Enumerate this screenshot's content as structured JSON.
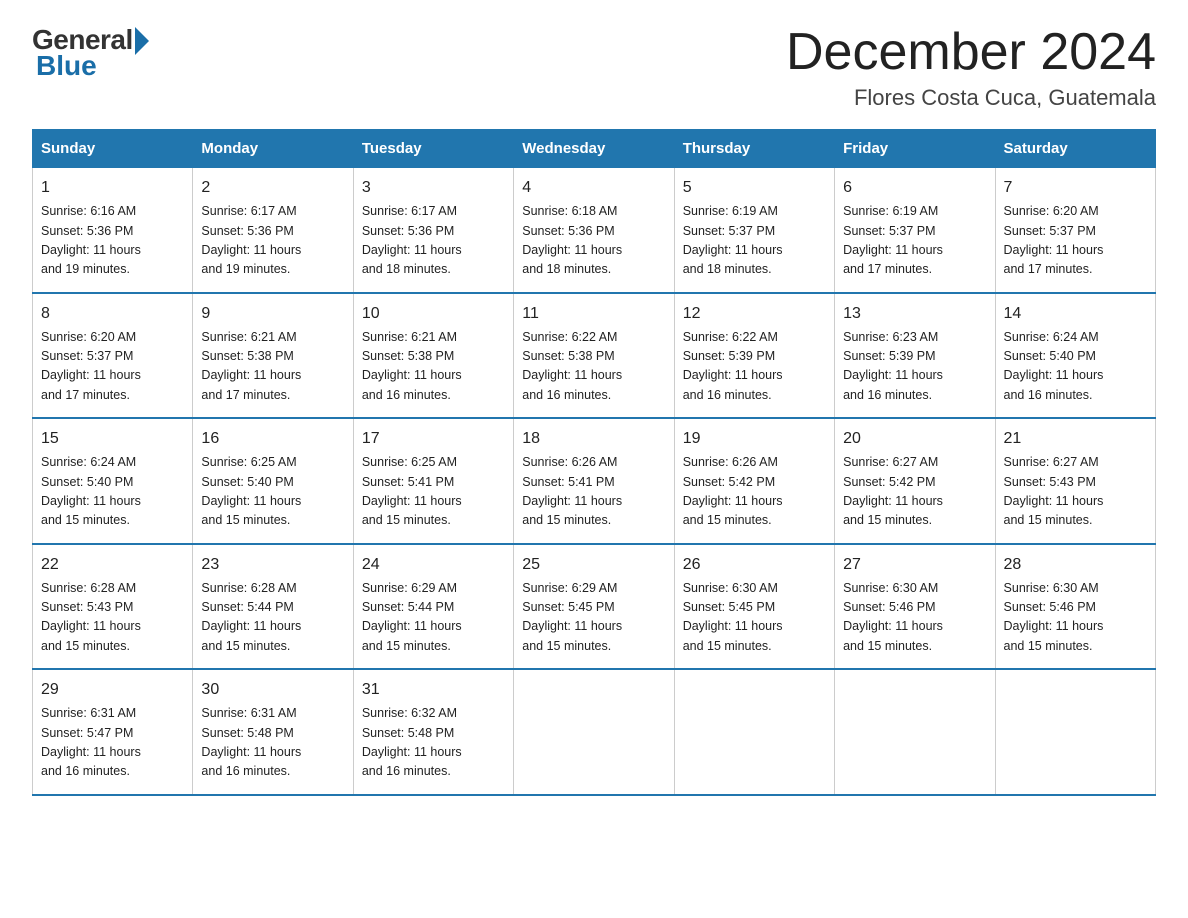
{
  "logo": {
    "general": "General",
    "blue": "Blue"
  },
  "title": "December 2024",
  "location": "Flores Costa Cuca, Guatemala",
  "days_of_week": [
    "Sunday",
    "Monday",
    "Tuesday",
    "Wednesday",
    "Thursday",
    "Friday",
    "Saturday"
  ],
  "weeks": [
    [
      {
        "day": "1",
        "sunrise": "6:16 AM",
        "sunset": "5:36 PM",
        "daylight": "11 hours and 19 minutes."
      },
      {
        "day": "2",
        "sunrise": "6:17 AM",
        "sunset": "5:36 PM",
        "daylight": "11 hours and 19 minutes."
      },
      {
        "day": "3",
        "sunrise": "6:17 AM",
        "sunset": "5:36 PM",
        "daylight": "11 hours and 18 minutes."
      },
      {
        "day": "4",
        "sunrise": "6:18 AM",
        "sunset": "5:36 PM",
        "daylight": "11 hours and 18 minutes."
      },
      {
        "day": "5",
        "sunrise": "6:19 AM",
        "sunset": "5:37 PM",
        "daylight": "11 hours and 18 minutes."
      },
      {
        "day": "6",
        "sunrise": "6:19 AM",
        "sunset": "5:37 PM",
        "daylight": "11 hours and 17 minutes."
      },
      {
        "day": "7",
        "sunrise": "6:20 AM",
        "sunset": "5:37 PM",
        "daylight": "11 hours and 17 minutes."
      }
    ],
    [
      {
        "day": "8",
        "sunrise": "6:20 AM",
        "sunset": "5:37 PM",
        "daylight": "11 hours and 17 minutes."
      },
      {
        "day": "9",
        "sunrise": "6:21 AM",
        "sunset": "5:38 PM",
        "daylight": "11 hours and 17 minutes."
      },
      {
        "day": "10",
        "sunrise": "6:21 AM",
        "sunset": "5:38 PM",
        "daylight": "11 hours and 16 minutes."
      },
      {
        "day": "11",
        "sunrise": "6:22 AM",
        "sunset": "5:38 PM",
        "daylight": "11 hours and 16 minutes."
      },
      {
        "day": "12",
        "sunrise": "6:22 AM",
        "sunset": "5:39 PM",
        "daylight": "11 hours and 16 minutes."
      },
      {
        "day": "13",
        "sunrise": "6:23 AM",
        "sunset": "5:39 PM",
        "daylight": "11 hours and 16 minutes."
      },
      {
        "day": "14",
        "sunrise": "6:24 AM",
        "sunset": "5:40 PM",
        "daylight": "11 hours and 16 minutes."
      }
    ],
    [
      {
        "day": "15",
        "sunrise": "6:24 AM",
        "sunset": "5:40 PM",
        "daylight": "11 hours and 15 minutes."
      },
      {
        "day": "16",
        "sunrise": "6:25 AM",
        "sunset": "5:40 PM",
        "daylight": "11 hours and 15 minutes."
      },
      {
        "day": "17",
        "sunrise": "6:25 AM",
        "sunset": "5:41 PM",
        "daylight": "11 hours and 15 minutes."
      },
      {
        "day": "18",
        "sunrise": "6:26 AM",
        "sunset": "5:41 PM",
        "daylight": "11 hours and 15 minutes."
      },
      {
        "day": "19",
        "sunrise": "6:26 AM",
        "sunset": "5:42 PM",
        "daylight": "11 hours and 15 minutes."
      },
      {
        "day": "20",
        "sunrise": "6:27 AM",
        "sunset": "5:42 PM",
        "daylight": "11 hours and 15 minutes."
      },
      {
        "day": "21",
        "sunrise": "6:27 AM",
        "sunset": "5:43 PM",
        "daylight": "11 hours and 15 minutes."
      }
    ],
    [
      {
        "day": "22",
        "sunrise": "6:28 AM",
        "sunset": "5:43 PM",
        "daylight": "11 hours and 15 minutes."
      },
      {
        "day": "23",
        "sunrise": "6:28 AM",
        "sunset": "5:44 PM",
        "daylight": "11 hours and 15 minutes."
      },
      {
        "day": "24",
        "sunrise": "6:29 AM",
        "sunset": "5:44 PM",
        "daylight": "11 hours and 15 minutes."
      },
      {
        "day": "25",
        "sunrise": "6:29 AM",
        "sunset": "5:45 PM",
        "daylight": "11 hours and 15 minutes."
      },
      {
        "day": "26",
        "sunrise": "6:30 AM",
        "sunset": "5:45 PM",
        "daylight": "11 hours and 15 minutes."
      },
      {
        "day": "27",
        "sunrise": "6:30 AM",
        "sunset": "5:46 PM",
        "daylight": "11 hours and 15 minutes."
      },
      {
        "day": "28",
        "sunrise": "6:30 AM",
        "sunset": "5:46 PM",
        "daylight": "11 hours and 15 minutes."
      }
    ],
    [
      {
        "day": "29",
        "sunrise": "6:31 AM",
        "sunset": "5:47 PM",
        "daylight": "11 hours and 16 minutes."
      },
      {
        "day": "30",
        "sunrise": "6:31 AM",
        "sunset": "5:48 PM",
        "daylight": "11 hours and 16 minutes."
      },
      {
        "day": "31",
        "sunrise": "6:32 AM",
        "sunset": "5:48 PM",
        "daylight": "11 hours and 16 minutes."
      },
      null,
      null,
      null,
      null
    ]
  ],
  "labels": {
    "sunrise": "Sunrise:",
    "sunset": "Sunset:",
    "daylight": "Daylight:"
  }
}
